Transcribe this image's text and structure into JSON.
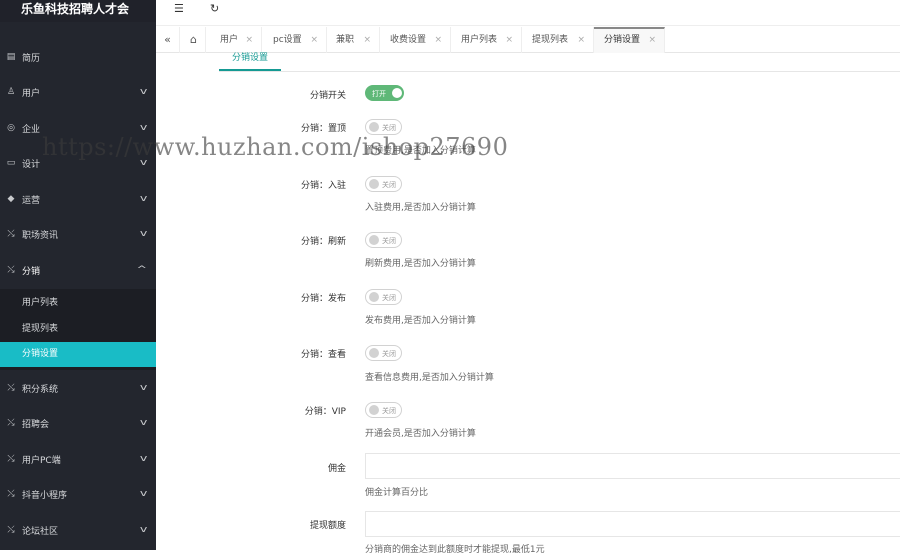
{
  "app": {
    "title": "乐鱼科技招聘人才会"
  },
  "header": {
    "collapse_icon": "indent-icon",
    "refresh_icon": "refresh-icon"
  },
  "sidebar": {
    "items": [
      {
        "label": "简历",
        "icon": "resume-icon",
        "has_children": false
      },
      {
        "label": "用户",
        "icon": "user-icon",
        "has_children": true
      },
      {
        "label": "企业",
        "icon": "shield-icon",
        "has_children": true
      },
      {
        "label": "设计",
        "icon": "layout-icon",
        "has_children": true
      },
      {
        "label": "运营",
        "icon": "megaphone-icon",
        "has_children": true
      },
      {
        "label": "职场资讯",
        "icon": "news-icon",
        "has_children": true
      },
      {
        "label": "分销",
        "icon": "share-icon",
        "has_children": true,
        "expanded": true,
        "children": [
          {
            "label": "用户列表"
          },
          {
            "label": "提现列表"
          },
          {
            "label": "分销设置",
            "active": true
          }
        ]
      },
      {
        "label": "积分系统",
        "icon": "points-icon",
        "has_children": true
      },
      {
        "label": "招聘会",
        "icon": "fair-icon",
        "has_children": true
      },
      {
        "label": "用户PC端",
        "icon": "pc-icon",
        "has_children": true
      },
      {
        "label": "抖音小程序",
        "icon": "douyin-icon",
        "has_children": true
      },
      {
        "label": "论坛社区",
        "icon": "forum-icon",
        "has_children": true
      }
    ]
  },
  "tabs": [
    {
      "label": "用户"
    },
    {
      "label": "pc设置"
    },
    {
      "label": "兼职"
    },
    {
      "label": "收费设置"
    },
    {
      "label": "用户列表"
    },
    {
      "label": "提现列表"
    },
    {
      "label": "分销设置",
      "active": true
    }
  ],
  "form": {
    "section_tab": "分销设置",
    "switch_on_text": "打开",
    "switch_off_text": "关闭",
    "rows": [
      {
        "label": "分销开关",
        "on": true,
        "hint": ""
      },
      {
        "label": "分销：置顶",
        "on": false,
        "hint": "置顶费用,是否加入分销计算"
      },
      {
        "label": "分销：入驻",
        "on": false,
        "hint": "入驻费用,是否加入分销计算"
      },
      {
        "label": "分销：刷新",
        "on": false,
        "hint": "刷新费用,是否加入分销计算"
      },
      {
        "label": "分销：发布",
        "on": false,
        "hint": "发布费用,是否加入分销计算"
      },
      {
        "label": "分销：查看",
        "on": false,
        "hint": "查看信息费用,是否加入分销计算"
      },
      {
        "label": "分销：VIP",
        "on": false,
        "hint": "开通会员,是否加入分销计算"
      }
    ],
    "commission": {
      "label": "佣金",
      "value": "",
      "hint": "佣金计算百分比"
    },
    "withdraw": {
      "label": "提现额度",
      "value": "",
      "hint": "分销商的佣金达到此额度时才能提现,最低1元"
    }
  },
  "watermark": "https://www.huzhan.com/ishop27690"
}
